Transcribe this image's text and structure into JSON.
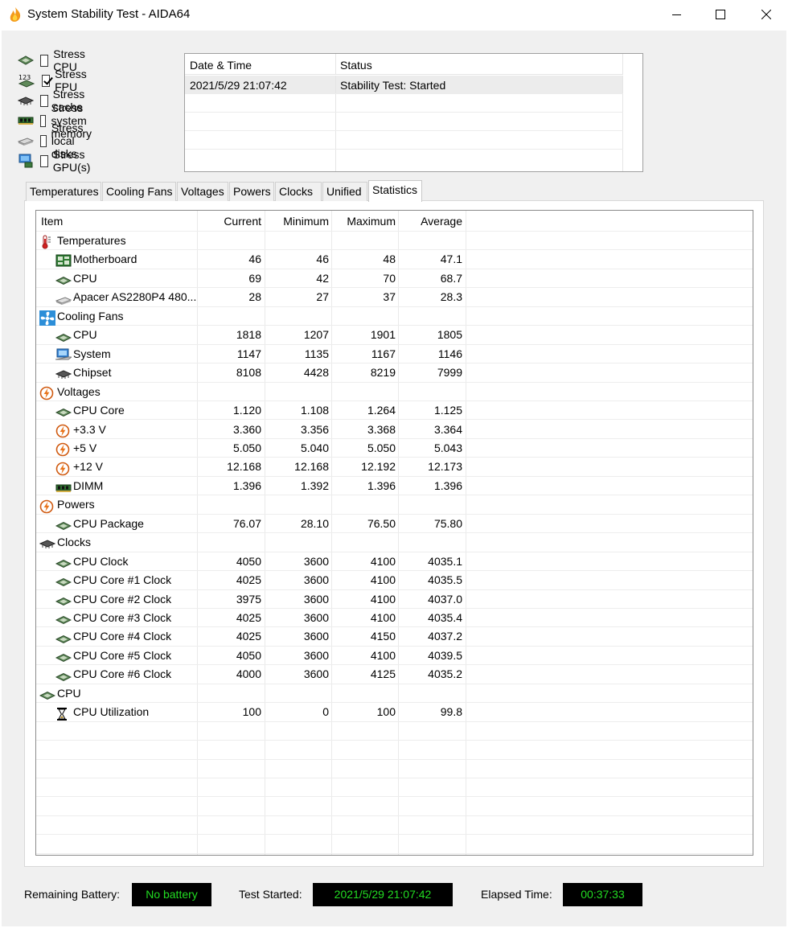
{
  "window": {
    "title": "System Stability Test - AIDA64"
  },
  "stress": [
    {
      "label": "Stress CPU",
      "checked": false,
      "icon": "cpu-chip-icon"
    },
    {
      "label": "Stress FPU",
      "checked": true,
      "icon": "fpu-123-icon"
    },
    {
      "label": "Stress cache",
      "checked": false,
      "icon": "cache-chip-icon"
    },
    {
      "label": "Stress system memory",
      "checked": false,
      "icon": "memory-module-icon"
    },
    {
      "label": "Stress local disks",
      "checked": false,
      "icon": "disk-drive-icon"
    },
    {
      "label": "Stress GPU(s)",
      "checked": false,
      "icon": "gpu-monitor-icon"
    }
  ],
  "log": {
    "headers": [
      "Date & Time",
      "Status"
    ],
    "rows": [
      [
        "2021/5/29 21:07:42",
        "Stability Test: Started"
      ]
    ]
  },
  "tabs": [
    "Temperatures",
    "Cooling Fans",
    "Voltages",
    "Powers",
    "Clocks",
    "Unified",
    "Statistics"
  ],
  "active_tab": "Statistics",
  "stats": {
    "headers": [
      "Item",
      "Current",
      "Minimum",
      "Maximum",
      "Average"
    ],
    "rows": [
      {
        "type": "group",
        "icon": "thermometer-icon",
        "item": "Temperatures"
      },
      {
        "type": "sub",
        "icon": "motherboard-icon",
        "item": "Motherboard",
        "cur": "46",
        "min": "46",
        "max": "48",
        "avg": "47.1"
      },
      {
        "type": "sub",
        "icon": "cpu-chip-icon",
        "item": "CPU",
        "cur": "69",
        "min": "42",
        "max": "70",
        "avg": "68.7"
      },
      {
        "type": "sub",
        "icon": "disk-drive-icon",
        "item": "Apacer AS2280P4 480...",
        "cur": "28",
        "min": "27",
        "max": "37",
        "avg": "28.3"
      },
      {
        "type": "group",
        "icon": "fan-icon",
        "item": "Cooling Fans"
      },
      {
        "type": "sub",
        "icon": "cpu-chip-icon",
        "item": "CPU",
        "cur": "1818",
        "min": "1207",
        "max": "1901",
        "avg": "1805"
      },
      {
        "type": "sub",
        "icon": "system-computer-icon",
        "item": "System",
        "cur": "1147",
        "min": "1135",
        "max": "1167",
        "avg": "1146"
      },
      {
        "type": "sub",
        "icon": "chipset-icon",
        "item": "Chipset",
        "cur": "8108",
        "min": "4428",
        "max": "8219",
        "avg": "7999"
      },
      {
        "type": "group",
        "icon": "voltage-bolt-icon",
        "item": "Voltages"
      },
      {
        "type": "sub",
        "icon": "cpu-chip-icon",
        "item": "CPU Core",
        "cur": "1.120",
        "min": "1.108",
        "max": "1.264",
        "avg": "1.125"
      },
      {
        "type": "sub",
        "icon": "voltage-bolt-icon",
        "item": "+3.3 V",
        "cur": "3.360",
        "min": "3.356",
        "max": "3.368",
        "avg": "3.364"
      },
      {
        "type": "sub",
        "icon": "voltage-bolt-icon",
        "item": "+5 V",
        "cur": "5.050",
        "min": "5.040",
        "max": "5.050",
        "avg": "5.043"
      },
      {
        "type": "sub",
        "icon": "voltage-bolt-icon",
        "item": "+12 V",
        "cur": "12.168",
        "min": "12.168",
        "max": "12.192",
        "avg": "12.173"
      },
      {
        "type": "sub",
        "icon": "memory-module-icon",
        "item": "DIMM",
        "cur": "1.396",
        "min": "1.392",
        "max": "1.396",
        "avg": "1.396"
      },
      {
        "type": "group",
        "icon": "voltage-bolt-icon",
        "item": "Powers"
      },
      {
        "type": "sub",
        "icon": "cpu-chip-icon",
        "item": "CPU Package",
        "cur": "76.07",
        "min": "28.10",
        "max": "76.50",
        "avg": "75.80"
      },
      {
        "type": "group",
        "icon": "chipset-icon",
        "item": "Clocks"
      },
      {
        "type": "sub",
        "icon": "cpu-chip-icon",
        "item": "CPU Clock",
        "cur": "4050",
        "min": "3600",
        "max": "4100",
        "avg": "4035.1"
      },
      {
        "type": "sub",
        "icon": "cpu-chip-icon",
        "item": "CPU Core #1 Clock",
        "cur": "4025",
        "min": "3600",
        "max": "4100",
        "avg": "4035.5"
      },
      {
        "type": "sub",
        "icon": "cpu-chip-icon",
        "item": "CPU Core #2 Clock",
        "cur": "3975",
        "min": "3600",
        "max": "4100",
        "avg": "4037.0"
      },
      {
        "type": "sub",
        "icon": "cpu-chip-icon",
        "item": "CPU Core #3 Clock",
        "cur": "4025",
        "min": "3600",
        "max": "4100",
        "avg": "4035.4"
      },
      {
        "type": "sub",
        "icon": "cpu-chip-icon",
        "item": "CPU Core #4 Clock",
        "cur": "4025",
        "min": "3600",
        "max": "4150",
        "avg": "4037.2"
      },
      {
        "type": "sub",
        "icon": "cpu-chip-icon",
        "item": "CPU Core #5 Clock",
        "cur": "4050",
        "min": "3600",
        "max": "4100",
        "avg": "4039.5"
      },
      {
        "type": "sub",
        "icon": "cpu-chip-icon",
        "item": "CPU Core #6 Clock",
        "cur": "4000",
        "min": "3600",
        "max": "4125",
        "avg": "4035.2"
      },
      {
        "type": "group",
        "icon": "cpu-chip-icon",
        "item": "CPU"
      },
      {
        "type": "sub",
        "icon": "hourglass-icon",
        "item": "CPU Utilization",
        "cur": "100",
        "min": "0",
        "max": "100",
        "avg": "99.8"
      }
    ]
  },
  "footer": {
    "battery_label": "Remaining Battery:",
    "battery_value": "No battery",
    "started_label": "Test Started:",
    "started_value": "2021/5/29 21:07:42",
    "elapsed_label": "Elapsed Time:",
    "elapsed_value": "00:37:33"
  },
  "colors": {
    "led_text": "#22dd22",
    "led_bg": "#000000"
  }
}
